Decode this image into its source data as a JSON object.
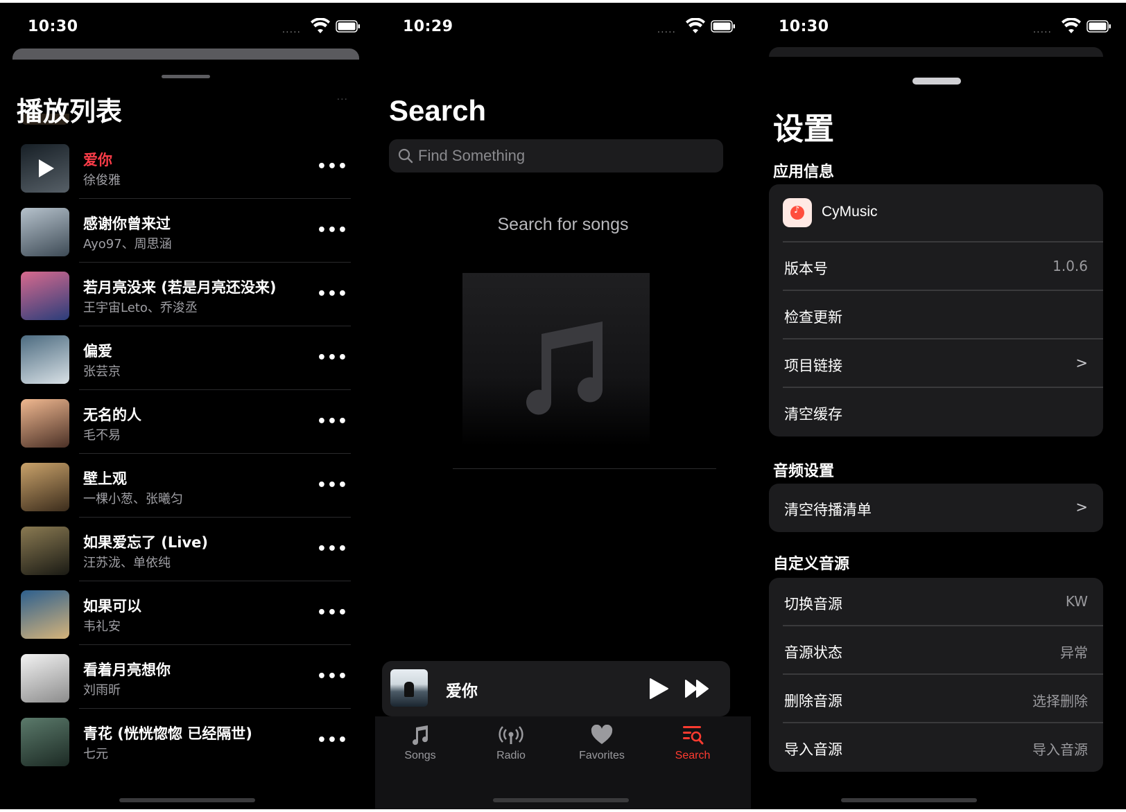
{
  "screen1": {
    "status": {
      "time": "10:30",
      "dots": "....."
    },
    "title": "播放列表",
    "more_hint": "···",
    "playlist": [
      {
        "song": "爱你",
        "artist": "徐俊雅",
        "playing": true,
        "cover": [
          "#1f2a33",
          "#74808a"
        ]
      },
      {
        "song": "感谢你曾来过",
        "artist": "Ayo97、周思涵",
        "playing": false,
        "cover": [
          "#b6c2cc",
          "#3d4a55"
        ]
      },
      {
        "song": "若月亮没来 (若是月亮还没来)",
        "artist": "王宇宙Leto、乔浚丞",
        "playing": false,
        "cover": [
          "#d86a8e",
          "#2a3d7a"
        ]
      },
      {
        "song": "偏爱",
        "artist": "张芸京",
        "playing": false,
        "cover": [
          "#4c6b80",
          "#d9e1e6"
        ]
      },
      {
        "song": "无名的人",
        "artist": "毛不易",
        "playing": false,
        "cover": [
          "#f0b890",
          "#4a3026"
        ]
      },
      {
        "song": "壁上观",
        "artist": "一棵小葱、张曦匀",
        "playing": false,
        "cover": [
          "#c9a26a",
          "#3b2c1c"
        ]
      },
      {
        "song": "如果爱忘了 (Live)",
        "artist": "汪苏泷、单依纯",
        "playing": false,
        "cover": [
          "#8a7a52",
          "#1a1a14"
        ]
      },
      {
        "song": "如果可以",
        "artist": "韦礼安",
        "playing": false,
        "cover": [
          "#2d5f8e",
          "#d6b47a"
        ]
      },
      {
        "song": "看着月亮想你",
        "artist": "刘雨昕",
        "playing": false,
        "cover": [
          "#f2f2f2",
          "#8c8c8c"
        ]
      },
      {
        "song": "青花 (恍恍惚惚 已经隔世)",
        "artist": "七元",
        "playing": false,
        "cover": [
          "#5b7a6b",
          "#1c2a24"
        ]
      }
    ]
  },
  "screen2": {
    "status": {
      "time": "10:29",
      "dots": "....."
    },
    "title": "Search",
    "search": {
      "placeholder": "Find Something",
      "value": ""
    },
    "hint": "Search for songs",
    "now_playing": {
      "title": "爱你"
    },
    "tabs": [
      {
        "label": "Songs",
        "icon": "music-note-icon",
        "active": false
      },
      {
        "label": "Radio",
        "icon": "radio-icon",
        "active": false
      },
      {
        "label": "Favorites",
        "icon": "heart-icon",
        "active": false
      },
      {
        "label": "Search",
        "icon": "search-list-icon",
        "active": true
      }
    ],
    "accent": "#ff3b30"
  },
  "screen3": {
    "status": {
      "time": "10:30",
      "dots": "....."
    },
    "title": "设置",
    "sections": {
      "app_info": {
        "header": "应用信息",
        "app_name": "CyMusic",
        "rows": [
          {
            "label": "版本号",
            "value": "1.0.6"
          },
          {
            "label": "检查更新",
            "value": ""
          },
          {
            "label": "项目链接",
            "value": ">"
          },
          {
            "label": "清空缓存",
            "value": ""
          }
        ]
      },
      "audio": {
        "header": "音频设置",
        "rows": [
          {
            "label": "清空待播清单",
            "value": ">"
          }
        ]
      },
      "custom_source": {
        "header": "自定义音源",
        "rows": [
          {
            "label": "切换音源",
            "value": "KW"
          },
          {
            "label": "音源状态",
            "value": "异常"
          },
          {
            "label": "删除音源",
            "value": "选择删除"
          },
          {
            "label": "导入音源",
            "value": "导入音源"
          }
        ]
      }
    }
  }
}
